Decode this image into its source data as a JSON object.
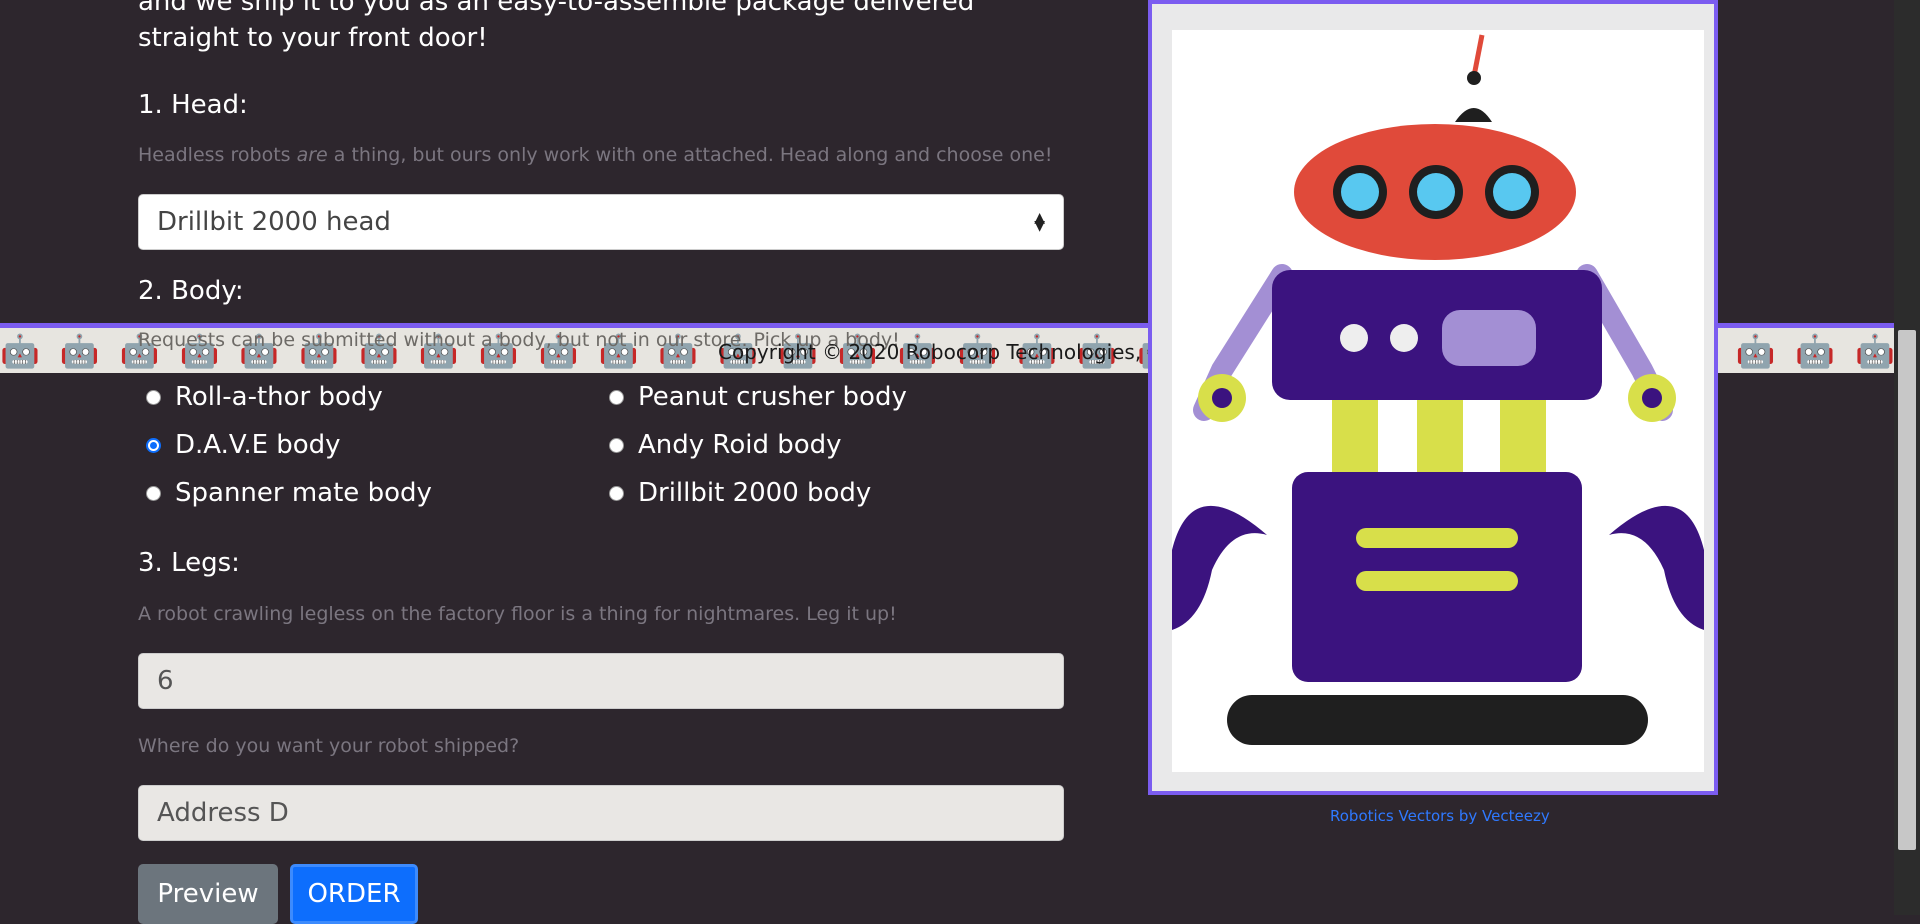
{
  "intro_text": "and we ship it to you as an easy-to-assemble package delivered straight to your front door!",
  "head": {
    "title": "1. Head:",
    "help_before": "Headless robots ",
    "help_em": "are",
    "help_after": " a thing, but ours only work with one attached. Head along and choose one!",
    "selected": "Drillbit 2000 head"
  },
  "body_section": {
    "title": "2. Body:",
    "help": "Requests can be submitted without a body, but not in our store. Pick up a body!",
    "options": [
      {
        "label": "Roll-a-thor body",
        "checked": false
      },
      {
        "label": "Peanut crusher body",
        "checked": false
      },
      {
        "label": "D.A.V.E body",
        "checked": true
      },
      {
        "label": "Andy Roid body",
        "checked": false
      },
      {
        "label": "Spanner mate body",
        "checked": false
      },
      {
        "label": "Drillbit 2000 body",
        "checked": false
      }
    ]
  },
  "legs": {
    "title": "3. Legs:",
    "help": "A robot crawling legless on the factory floor is a thing for nightmares. Leg it up!",
    "value": "6"
  },
  "address": {
    "question": "Where do you want your robot shipped?",
    "value": "Address D"
  },
  "buttons": {
    "preview": "Preview",
    "order": "ORDER"
  },
  "footer": {
    "copyright": "Copyright © 2020 Robocorp Technologies, I"
  },
  "image_credit": "Robotics Vectors by Vecteezy",
  "colors": {
    "accent": "#7b5cf0",
    "primary": "#0d6efd",
    "background": "#2d262d"
  }
}
